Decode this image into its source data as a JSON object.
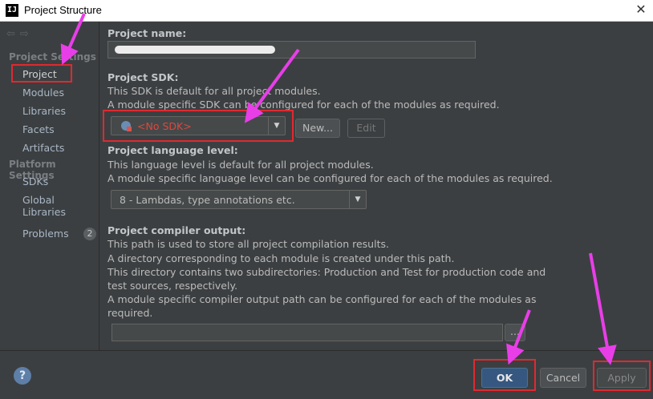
{
  "window": {
    "app_icon": "IJ",
    "title": "Project Structure",
    "close_glyph": "✕"
  },
  "sidebar": {
    "back_glyph": "⇦",
    "forward_glyph": "⇨",
    "project_settings_header": "Project Settings",
    "project_items": [
      "Project",
      "Modules",
      "Libraries",
      "Facets",
      "Artifacts"
    ],
    "platform_settings_header": "Platform Settings",
    "platform_items": [
      "SDKs",
      "Global Libraries"
    ],
    "problems_label": "Problems",
    "problems_count": "2"
  },
  "main": {
    "project_name_label": "Project name:",
    "project_name_value": "",
    "sdk_label": "Project SDK:",
    "sdk_desc1": "This SDK is default for all project modules.",
    "sdk_desc2": "A module specific SDK can be configured for each of the modules as required.",
    "sdk_value": "<No SDK>",
    "new_button": "New...",
    "edit_button": "Edit",
    "lang_label": "Project language level:",
    "lang_desc1": "This language level is default for all project modules.",
    "lang_desc2": "A module specific language level can be configured for each of the modules as required.",
    "lang_value": "8 - Lambdas, type annotations etc.",
    "compiler_label": "Project compiler output:",
    "compiler_desc": [
      "This path is used to store all project compilation results.",
      "A directory corresponding to each module is created under this path.",
      "This directory contains two subdirectories: Production and Test for production code and",
      "test sources, respectively.",
      "A module specific compiler output path can be configured for each of the modules as",
      "required."
    ],
    "compiler_output_value": "",
    "browse_button": "..."
  },
  "footer": {
    "help_glyph": "?",
    "ok": "OK",
    "cancel": "Cancel",
    "apply": "Apply"
  },
  "colors": {
    "annotation": "#e0292f",
    "arrow": "#e83ee8",
    "sdk_text": "#e0463c",
    "background": "#3c3f41"
  }
}
